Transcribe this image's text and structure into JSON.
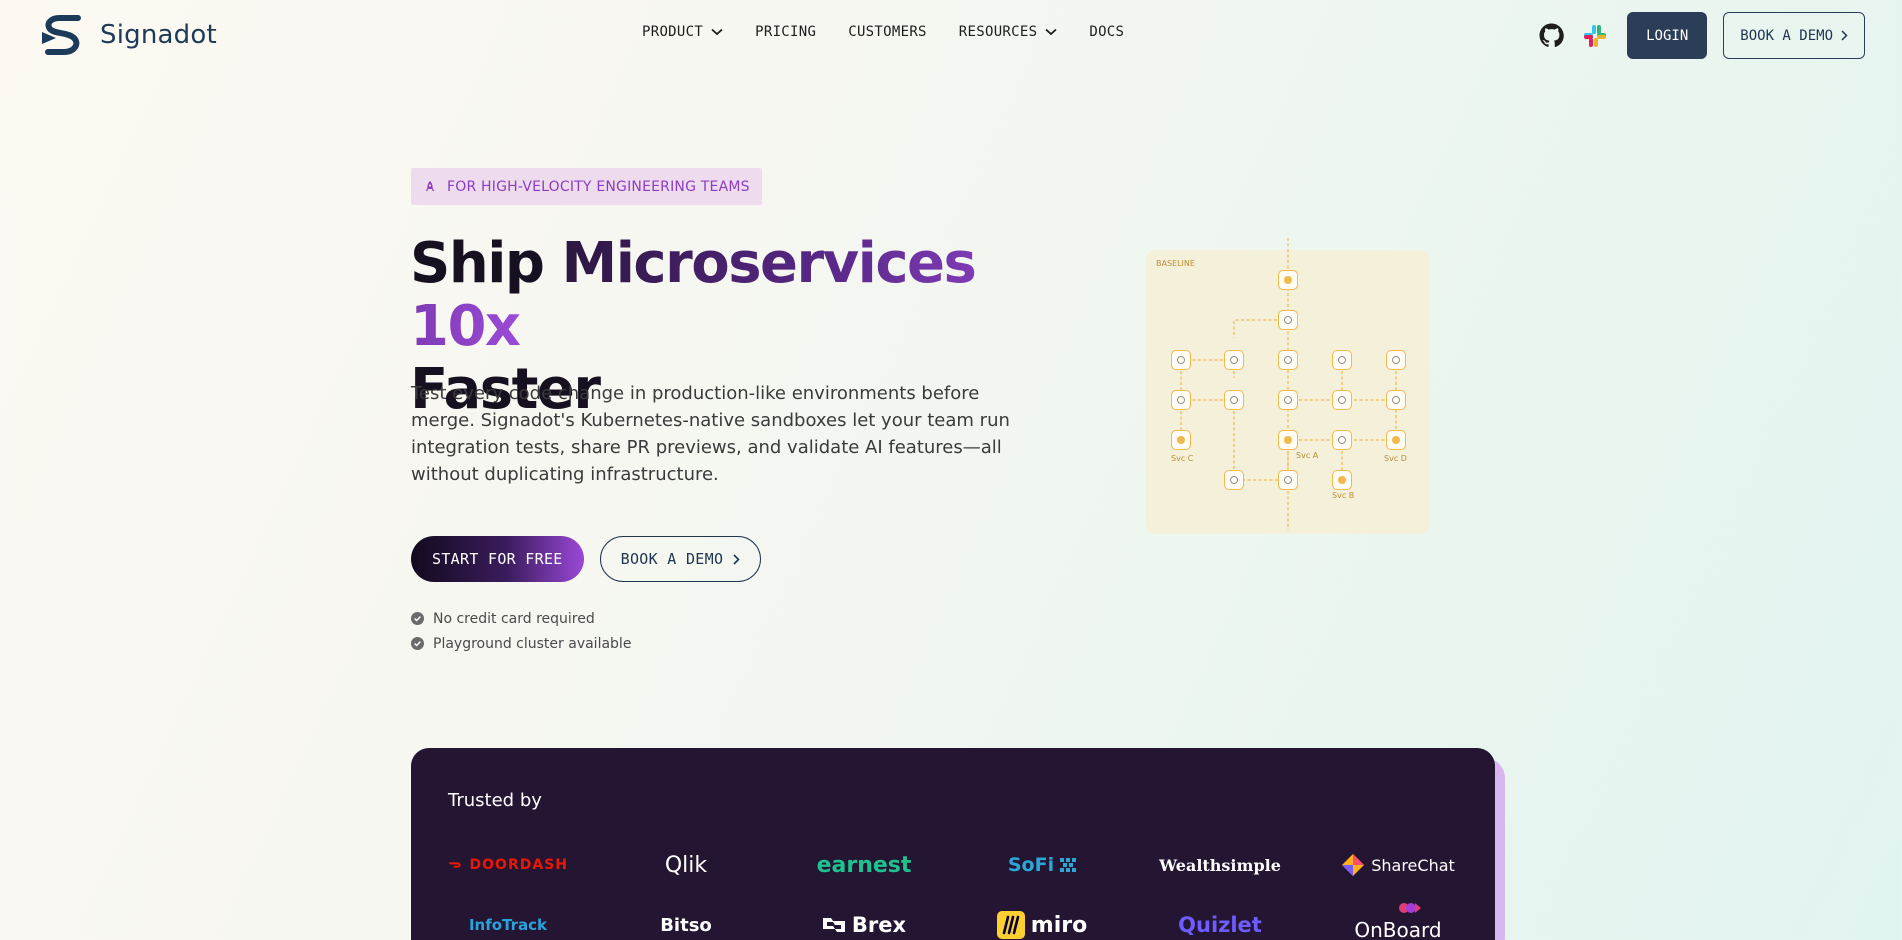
{
  "header": {
    "brand": "Signadot",
    "nav": [
      {
        "label": "PRODUCT",
        "has_dropdown": true
      },
      {
        "label": "PRICING",
        "has_dropdown": false
      },
      {
        "label": "CUSTOMERS",
        "has_dropdown": false
      },
      {
        "label": "RESOURCES",
        "has_dropdown": true
      },
      {
        "label": "DOCS",
        "has_dropdown": false
      }
    ],
    "icons": [
      "github-icon",
      "slack-icon"
    ],
    "login_label": "LOGIN",
    "demo_label": "BOOK A DEMO"
  },
  "hero": {
    "badge": "FOR HIGH-VELOCITY ENGINEERING TEAMS",
    "title_line1_a": "Ship ",
    "title_line1_b": "Microservices 10x",
    "title_line2": "Faster",
    "description": "Test every code change in production-like environments before merge. Signadot's Kubernetes-native sandboxes let your team run integration tests, share PR previews, and validate AI features—all without duplicating infrastructure.",
    "cta_primary": "START FOR FREE",
    "cta_secondary": "BOOK A DEMO",
    "checks": [
      "No credit card required",
      "Playground cluster available"
    ]
  },
  "diagram": {
    "label": "BASELINE",
    "service_labels": [
      "Svc C",
      "Svc A",
      "Svc D",
      "Svc B"
    ],
    "accent_color": "#f2b544"
  },
  "trusted": {
    "label": "Trusted by",
    "logos_row1": [
      "DOORDASH",
      "Qlik",
      "earnest",
      "SoFi",
      "Wealthsimple",
      "ShareChat"
    ],
    "logos_row2": [
      "InfoTrack",
      "Bitso",
      "Brex",
      "miro",
      "Quizlet",
      "OnBoard"
    ]
  },
  "colors": {
    "navy": "#2c3e57",
    "purple": "#9b4ad6",
    "dark_panel": "#241533"
  }
}
